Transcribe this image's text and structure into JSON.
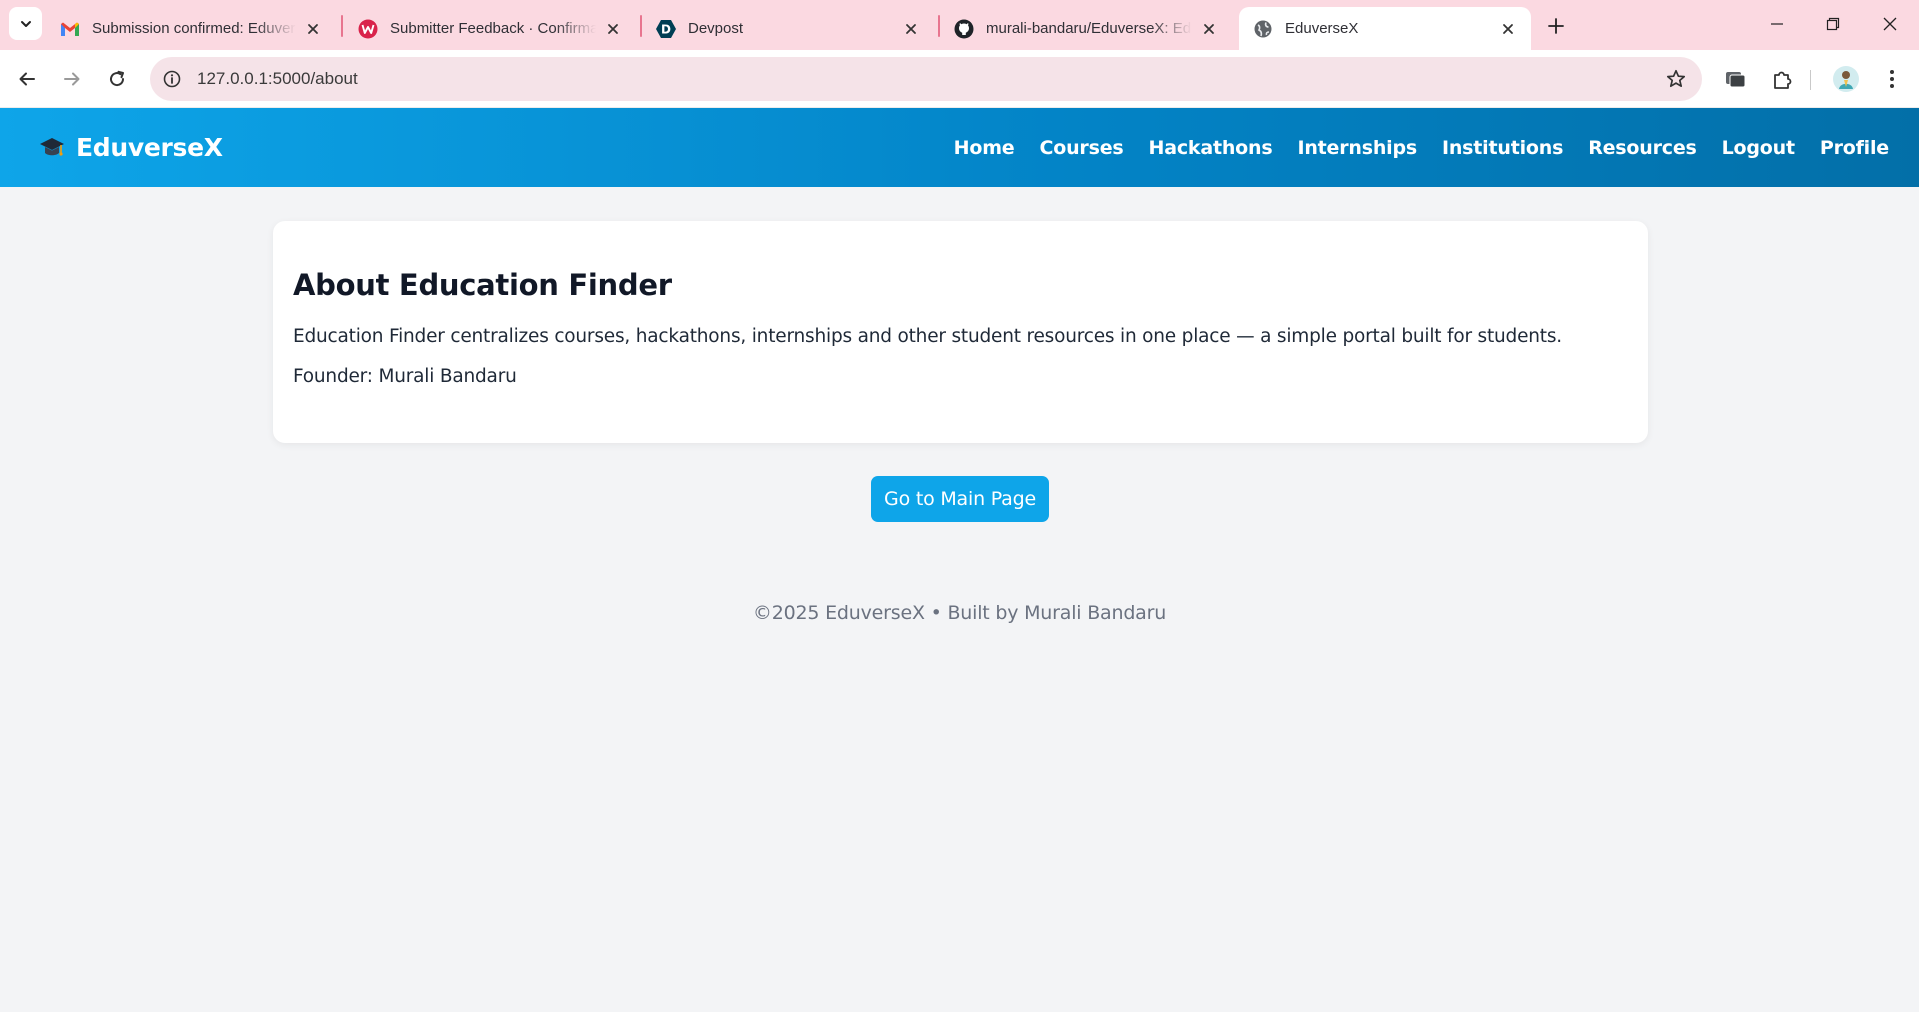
{
  "browser": {
    "tabs": [
      {
        "title": "Submission confirmed: EduverseX",
        "icon": "gmail-icon"
      },
      {
        "title": "Submitter Feedback · Confirmation",
        "icon": "w-logo-icon"
      },
      {
        "title": "Devpost",
        "icon": "devpost-icon"
      },
      {
        "title": "murali-bandaru/EduverseX: EduverseX",
        "icon": "github-icon"
      },
      {
        "title": "EduverseX",
        "icon": "globe-icon",
        "active": true
      }
    ],
    "url": "127.0.0.1:5000/about"
  },
  "site": {
    "brand": "EduverseX",
    "nav": [
      "Home",
      "Courses",
      "Hackathons",
      "Internships",
      "Institutions",
      "Resources",
      "Logout",
      "Profile"
    ],
    "colors": {
      "nav_start": "#0ea5e9",
      "nav_end": "#036fa8",
      "button": "#0ea5e9"
    }
  },
  "about": {
    "title": "About Education Finder",
    "description": "Education Finder centralizes courses, hackathons, internships and other student resources in one place — a simple portal built for students.",
    "founder": "Founder: Murali Bandaru"
  },
  "main_button": "Go to Main Page",
  "footer": "©2025 EduverseX • Built by Murali Bandaru"
}
